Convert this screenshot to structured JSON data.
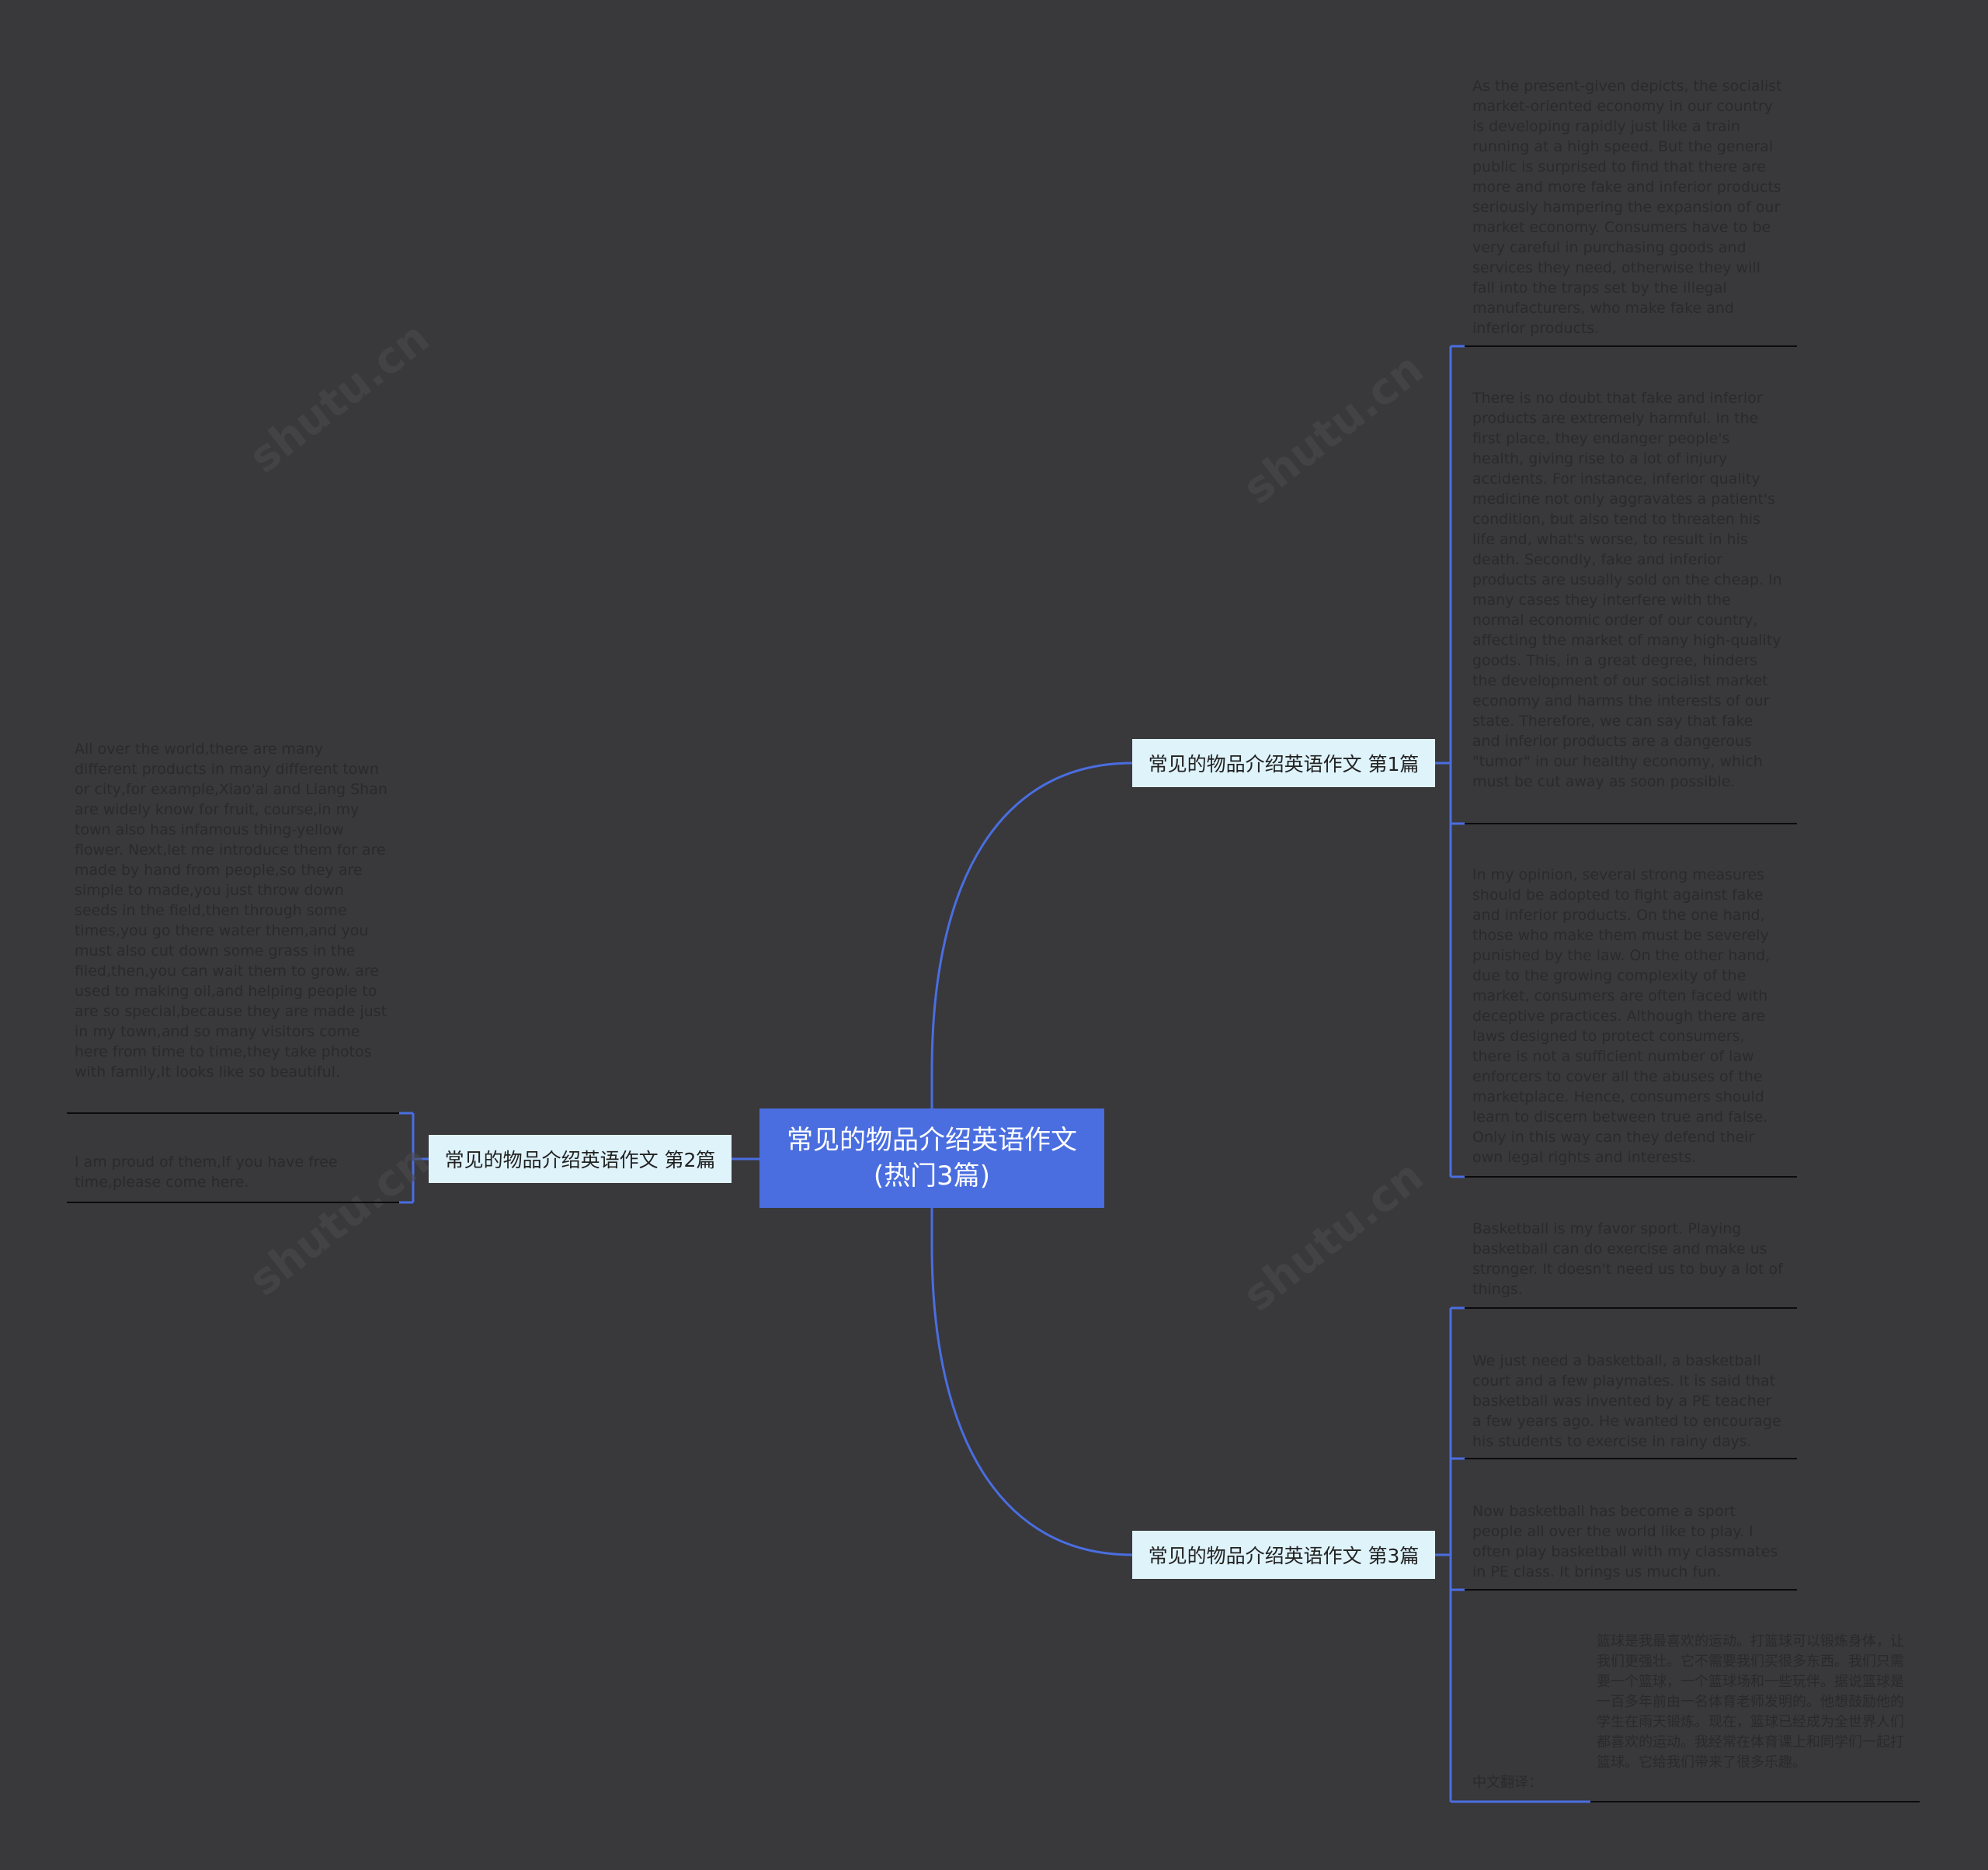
{
  "colors": {
    "background": "#39383b",
    "root": "#4a6ee0",
    "branch": "#dff3fb",
    "connector": "#4a6ee0",
    "leaf_text": "#2a2a2c",
    "underline": "#0b0b0d"
  },
  "watermark": "shutu.cn",
  "root": {
    "title": "常见的物品介绍英语作文(热门3篇)"
  },
  "branches": [
    {
      "label": "常见的物品介绍英语作文 第1篇",
      "leaves": [
        "As the present-given depicts, the socialist market-oriented economy in our country is developing rapidly just like a train running at a high speed. But the general public is surprised to find that there are more and more fake and inferior products seriously hampering the expansion of our market economy. Consumers have to be very careful in purchasing goods and services they need, otherwise they will fall into the traps set by the illegal manufacturers, who make fake and inferior products.",
        "There is no doubt that fake and inferior products are extremely harmful. In the first place, they endanger people's health, giving rise to a lot of injury accidents. For instance, inferior quality medicine not only aggravates a patient's condition, but also tend to threaten his life and, what's worse, to result in his death. Secondly, fake and inferior products are usually sold on the cheap. In many cases they interfere with the normal economic order of our country, affecting the market of many high-quality goods. This, in a great degree, hinders the development of our socialist market economy and harms the interests of our state. Therefore, we can say that fake and inferior products are a dangerous \"tumor\" in our healthy economy, which must be cut away as soon possible.",
        "In my opinion, several strong measures should be adopted to fight against fake and inferior products. On the one hand, those who make them must be severely punished by the law. On the other hand, due to the growing complexity of the market, consumers are often faced with deceptive practices. Although there are laws designed to protect consumers, there is not a sufficient number of law enforcers to cover all the abuses of the marketplace. Hence, consumers should learn to discern between true and false. Only in this way can they defend their own legal rights and interests."
      ]
    },
    {
      "label": "常见的物品介绍英语作文 第2篇",
      "leaves": [
        "All over the world,there are many different products in many different town or city,for example,Xiao'ai and Liang Shan are widely know for fruit, course,in my town also has infamous thing-yellow flower. Next,let me introduce them for are made by hand from people,so they are simple to made,you just throw down seeds in the field,then through some times,you go there water them,and you must also cut down some grass in the filed,then,you can wait them to grow. are used to making oil,and helping people to are so special,because they are made just in my town,and so many visitors come here from time to time,they take photos with family,It looks like so beautiful.",
        "I am proud of them,If you have free time,please come here."
      ]
    },
    {
      "label": "常见的物品介绍英语作文 第3篇",
      "leaves": [
        "Basketball is my favor sport. Playing basketball can do exercise and make us stronger. It doesn't need us to buy a lot of things.",
        "We just need a basketball, a basketball court and a few playmates. It is said that basketball was invented by a PE teacher a few years ago. He wanted to encourage his students to exercise in rainy days.",
        "Now basketball has become a sport people all over the world like to play. I often play basketball with my classmates in PE class. It brings us much fun.",
        "篮球是我最喜欢的运动。打篮球可以锻炼身体，让我们更强壮。它不需要我们买很多东西。我们只需要一个篮球，一个篮球场和一些玩伴。据说篮球是一百多年前由一名体育老师发明的。他想鼓励他的学生在雨天锻炼。现在，篮球已经成为全世界人们都喜欢的运动。我经常在体育课上和同学们一起打篮球。它给我们带来了很多乐趣。",
        "中文翻译："
      ]
    }
  ]
}
